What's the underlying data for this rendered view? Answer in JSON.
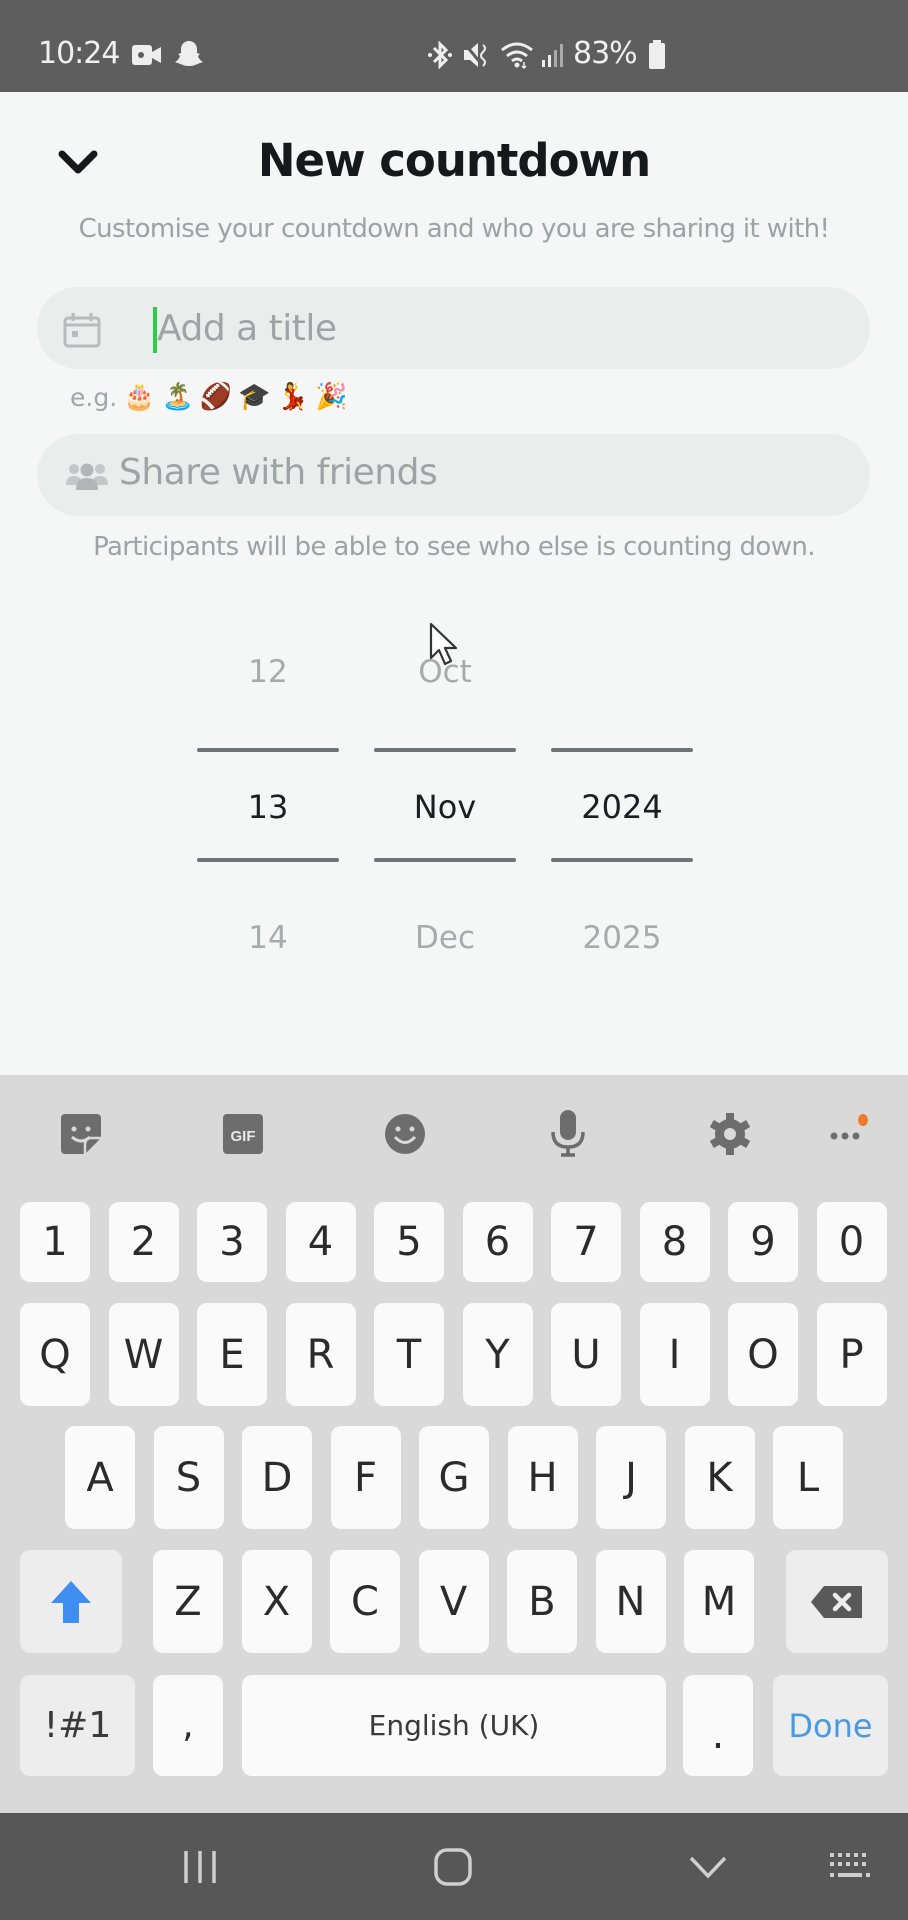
{
  "status_bar": {
    "time": "10:24",
    "left_icons": [
      "video-camera-icon",
      "snapchat-ghost-icon"
    ],
    "right_icons": [
      "bluetooth-icon",
      "mute-icon",
      "wifi-icon",
      "signal-icon"
    ],
    "battery_percent": "83%",
    "battery_level": 0.83
  },
  "header": {
    "back_icon": "chevron-down-icon",
    "title": "New countdown",
    "subtitle": "Customise your countdown and who you are sharing it with!"
  },
  "title_input": {
    "icon": "calendar-icon",
    "value": "",
    "placeholder": "Add a title"
  },
  "examples": {
    "prefix": "e.g.",
    "emojis": [
      "🎂",
      "🏝️",
      "🏈",
      "🎓",
      "💃",
      "🎉"
    ]
  },
  "share_input": {
    "icon": "friends-icon",
    "label": "Share with friends",
    "hint": "Participants will be able to see who else is counting down."
  },
  "date_picker": {
    "day": {
      "prev": "12",
      "selected": "13",
      "next": "14"
    },
    "month": {
      "prev": "Oct",
      "selected": "Nov",
      "next": "Dec"
    },
    "year": {
      "prev": "",
      "selected": "2024",
      "next": "2025"
    }
  },
  "keyboard": {
    "toolbar": [
      "sticker-icon",
      "gif-icon",
      "emoji-icon",
      "microphone-icon",
      "settings-icon",
      "more-icon"
    ],
    "gif_label": "GIF",
    "notification_color": "#f07a2a",
    "rows": [
      [
        "1",
        "2",
        "3",
        "4",
        "5",
        "6",
        "7",
        "8",
        "9",
        "0"
      ],
      [
        "Q",
        "W",
        "E",
        "R",
        "T",
        "Y",
        "U",
        "I",
        "O",
        "P"
      ],
      [
        "A",
        "S",
        "D",
        "F",
        "G",
        "H",
        "J",
        "K",
        "L"
      ],
      [
        "Z",
        "X",
        "C",
        "V",
        "B",
        "N",
        "M"
      ]
    ],
    "symbols_label": "!#1",
    "comma_label": ",",
    "space_label": "English (UK)",
    "period_label": ".",
    "done_label": "Done",
    "accent_color": "#4a9ae0"
  },
  "nav_bar": {
    "buttons": [
      "recent-apps-icon",
      "home-icon",
      "hide-keyboard-icon",
      "keyboard-switch-icon"
    ]
  }
}
